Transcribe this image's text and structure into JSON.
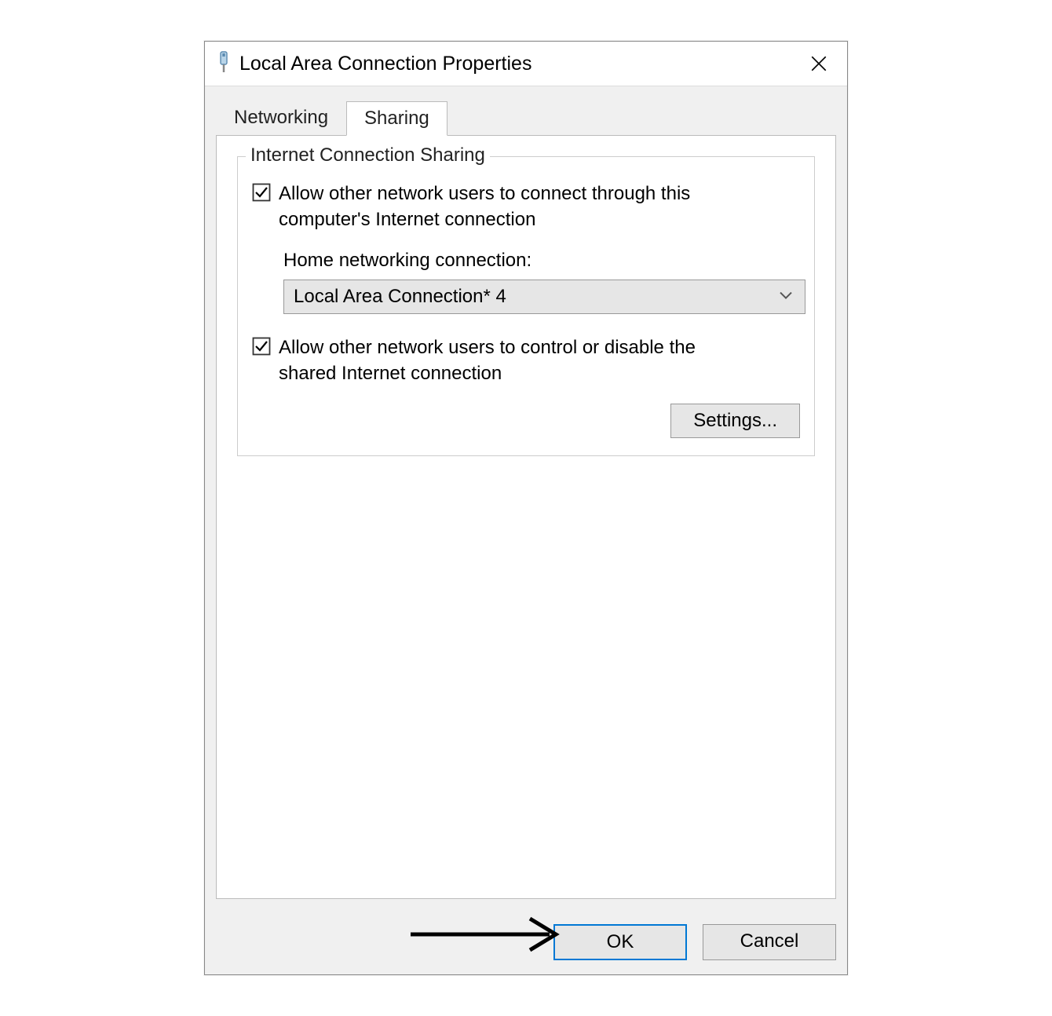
{
  "window": {
    "title": "Local Area Connection Properties"
  },
  "tabs": {
    "networking": "Networking",
    "sharing": "Sharing",
    "active": "sharing"
  },
  "groupbox": {
    "legend": "Internet Connection Sharing",
    "checkbox1": {
      "checked": true,
      "label": "Allow other network users to connect through this computer's Internet connection"
    },
    "home_label": "Home networking connection:",
    "dropdown_value": "Local Area Connection* 4",
    "checkbox2": {
      "checked": true,
      "label": "Allow other network users to control or disable the shared Internet connection"
    },
    "settings_button": "Settings..."
  },
  "buttons": {
    "ok": "OK",
    "cancel": "Cancel"
  }
}
